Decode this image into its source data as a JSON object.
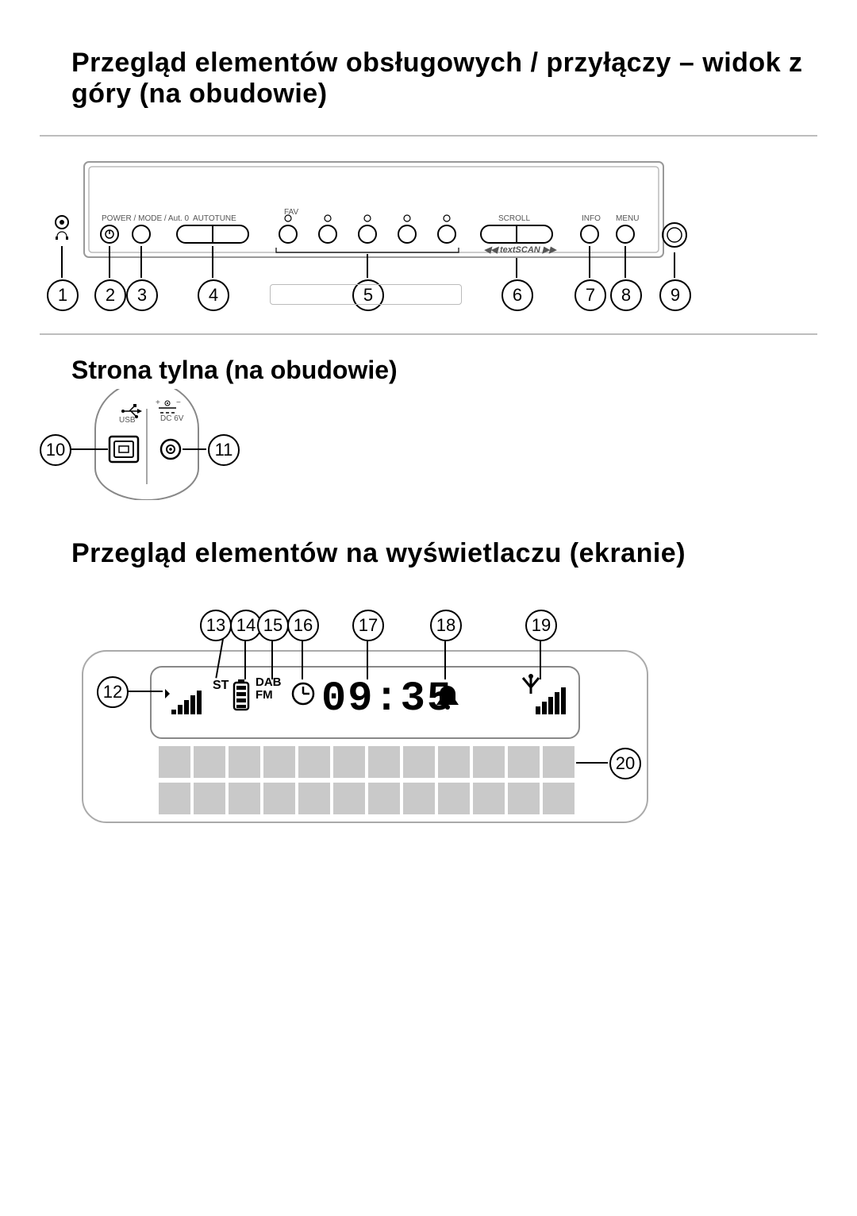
{
  "section1_title": "Przegląd elementów obsługowych / przyłączy – widok z góry (na obudowie)",
  "section2_title": "Przegląd elementów na wyświetlaczu (ekranie)",
  "rear_title": "Strona tylna (na obudowie)",
  "top": {
    "label_power": "POWER / MODE / Aut. 0",
    "label_autotune": "AUTOTUNE",
    "label_fav": "FAV",
    "label_scan": "◀◀  textSCAN  ▶▶",
    "label_scan_btn": "SCROLL",
    "label_info": "INFO",
    "label_menu": "MENU"
  },
  "rear": {
    "usb_label": "USB",
    "dc_label": "DC 6V"
  },
  "display": {
    "st": "ST",
    "dab": "DAB",
    "fm": "FM",
    "time": "09:35"
  },
  "callouts": {
    "c1": "1",
    "c2": "2",
    "c3": "3",
    "c4": "4",
    "c5": "5",
    "c6": "6",
    "c7": "7",
    "c8": "8",
    "c9": "9",
    "c10": "10",
    "c11": "11",
    "c12": "12",
    "c13": "13",
    "c14": "14",
    "c15": "15",
    "c16": "16",
    "c17": "17",
    "c18": "18",
    "c19": "19",
    "c20": "20"
  }
}
